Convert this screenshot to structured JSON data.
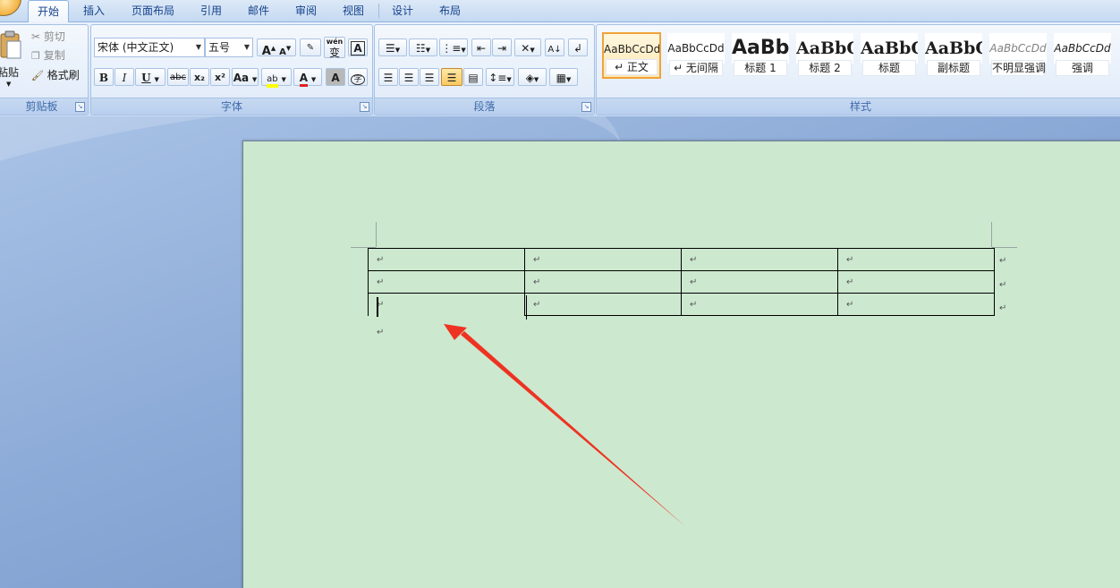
{
  "tabs": [
    {
      "label": "开始",
      "active": true
    },
    {
      "label": "插入"
    },
    {
      "label": "页面布局"
    },
    {
      "label": "引用"
    },
    {
      "label": "邮件"
    },
    {
      "label": "审阅"
    },
    {
      "label": "视图"
    },
    {
      "label": "设计"
    },
    {
      "label": "布局"
    }
  ],
  "clipboard": {
    "paste": "粘贴",
    "cut": "剪切",
    "copy": "复制",
    "format_painter": "格式刷",
    "title": "剪贴板"
  },
  "font": {
    "name": "宋体 (中文正文)",
    "size": "五号",
    "grow": "A",
    "shrink": "A",
    "wen": "wén",
    "bian": "变",
    "clear": "A",
    "bold": "B",
    "italic": "I",
    "underline": "U",
    "strike": "abc",
    "subscript": "x₂",
    "superscript": "x²",
    "case": "Aa",
    "highlight": "ab",
    "color": "A",
    "shade": "A",
    "enclose": "字",
    "title": "字体"
  },
  "paragraph": {
    "title": "段落"
  },
  "styles": {
    "title": "样式",
    "items": [
      {
        "sample": "AaBbCcDd",
        "name": "↵ 正文",
        "selected": true
      },
      {
        "sample": "AaBbCcDd",
        "name": "↵ 无间隔"
      },
      {
        "sample": "AaBb",
        "name": "标题 1"
      },
      {
        "sample": "AaBbC",
        "name": "标题 2"
      },
      {
        "sample": "AaBbC",
        "name": "标题"
      },
      {
        "sample": "AaBbC",
        "name": "副标题"
      },
      {
        "sample": "AaBbCcDd",
        "name": "不明显强调"
      },
      {
        "sample": "AaBbCcDd",
        "name": "强调"
      }
    ]
  },
  "document": {
    "para_mark": "↵",
    "table_rows": 3,
    "table_cols": 4
  },
  "colors": {
    "page_bg": "#cce8cf",
    "annotation_arrow": "#ee3322",
    "highlight_yellow": "#ffff00",
    "font_color_red": "#e02020"
  }
}
